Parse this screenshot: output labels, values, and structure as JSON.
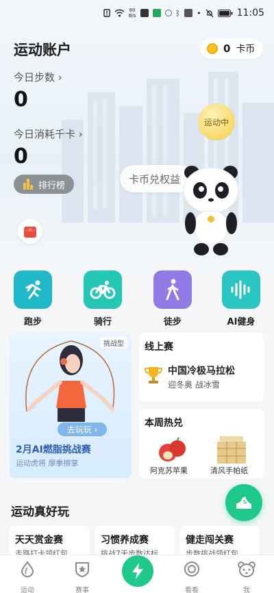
{
  "status_bar": {
    "net_speed_value": "80",
    "net_speed_unit": "B/s",
    "time": "11:05"
  },
  "header": {
    "title": "运动账户",
    "coins_value": "0",
    "coins_label": "卡币"
  },
  "stats": {
    "steps_label": "今日步数 ›",
    "steps_value": "0",
    "kcal_label": "今日消耗千卡 ›",
    "kcal_value": "0",
    "rank_label": "排行榜"
  },
  "hero": {
    "status_bubble": "运动中",
    "exchange_label": "卡币兑权益"
  },
  "modes": [
    {
      "label": "跑步",
      "color": "#21b8c9"
    },
    {
      "label": "骑行",
      "color": "#24c6b6"
    },
    {
      "label": "徒步",
      "color": "#8f7ae6"
    },
    {
      "label": "AI健身",
      "color": "#2bc6c3"
    }
  ],
  "challenge": {
    "tag": "挑战型",
    "button": "去玩玩 ›",
    "title": "2月AI燃脂挑战赛",
    "subtitle": "运动虎将 摩拳擦掌"
  },
  "online_race": {
    "title": "线上赛",
    "name": "中国冷极马拉松",
    "subtitle": "迎冬奥 战冰雪"
  },
  "weekly_hot": {
    "title": "本周热兑",
    "items": [
      "阿克苏苹果",
      "清风手帕纸"
    ]
  },
  "fun_section": {
    "title": "运动真好玩",
    "cards": [
      {
        "name": "天天赏金赛",
        "desc": "走路打卡领红包"
      },
      {
        "name": "习惯养成赛",
        "desc": "挑战7天步数达标"
      },
      {
        "name": "健走闯关赛",
        "desc": "步数挑战领红包"
      }
    ]
  },
  "tabbar": {
    "items": [
      {
        "label": "运动",
        "icon": "drop-icon"
      },
      {
        "label": "赛事",
        "icon": "shield-star-icon"
      },
      {
        "label": "",
        "icon": "lightning-icon"
      },
      {
        "label": "看看",
        "icon": "ring-icon"
      },
      {
        "label": "我",
        "icon": "bear-face-icon"
      }
    ]
  }
}
